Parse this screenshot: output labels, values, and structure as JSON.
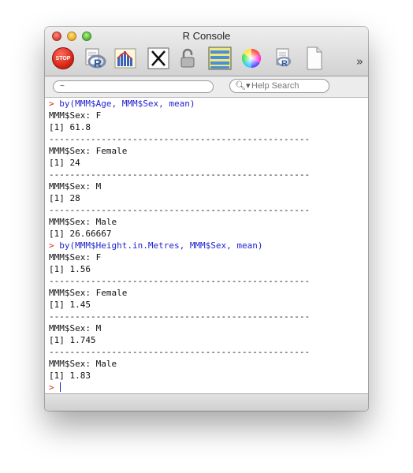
{
  "window": {
    "title": "R Console"
  },
  "toolbar": {
    "items": [
      {
        "name": "stop",
        "label": "STOP"
      },
      {
        "name": "source-script"
      },
      {
        "name": "quartz-plot"
      },
      {
        "name": "x11"
      },
      {
        "name": "authorize-lock"
      },
      {
        "name": "show-history"
      },
      {
        "name": "color-wheel"
      },
      {
        "name": "print"
      },
      {
        "name": "new-document"
      }
    ],
    "overflow": "»"
  },
  "searchbar": {
    "path": "~",
    "help_placeholder": "Help Search"
  },
  "console": {
    "lines": [
      {
        "type": "cmd",
        "prompt": "> ",
        "text": "by(MMM$Age, MMM$Sex, mean)"
      },
      {
        "type": "out",
        "text": "MMM$Sex: F"
      },
      {
        "type": "out",
        "text": "[1] 61.8"
      },
      {
        "type": "out",
        "text": "--------------------------------------------------"
      },
      {
        "type": "out",
        "text": "MMM$Sex: Female"
      },
      {
        "type": "out",
        "text": "[1] 24"
      },
      {
        "type": "out",
        "text": "--------------------------------------------------"
      },
      {
        "type": "out",
        "text": "MMM$Sex: M"
      },
      {
        "type": "out",
        "text": "[1] 28"
      },
      {
        "type": "out",
        "text": "--------------------------------------------------"
      },
      {
        "type": "out",
        "text": "MMM$Sex: Male"
      },
      {
        "type": "out",
        "text": "[1] 26.66667"
      },
      {
        "type": "cmd",
        "prompt": "> ",
        "text": "by(MMM$Height.in.Metres, MMM$Sex, mean)"
      },
      {
        "type": "out",
        "text": "MMM$Sex: F"
      },
      {
        "type": "out",
        "text": "[1] 1.56"
      },
      {
        "type": "out",
        "text": "--------------------------------------------------"
      },
      {
        "type": "out",
        "text": "MMM$Sex: Female"
      },
      {
        "type": "out",
        "text": "[1] 1.45"
      },
      {
        "type": "out",
        "text": "--------------------------------------------------"
      },
      {
        "type": "out",
        "text": "MMM$Sex: M"
      },
      {
        "type": "out",
        "text": "[1] 1.745"
      },
      {
        "type": "out",
        "text": "--------------------------------------------------"
      },
      {
        "type": "out",
        "text": "MMM$Sex: Male"
      },
      {
        "type": "out",
        "text": "[1] 1.83"
      },
      {
        "type": "input",
        "prompt": "> ",
        "text": ""
      }
    ]
  }
}
